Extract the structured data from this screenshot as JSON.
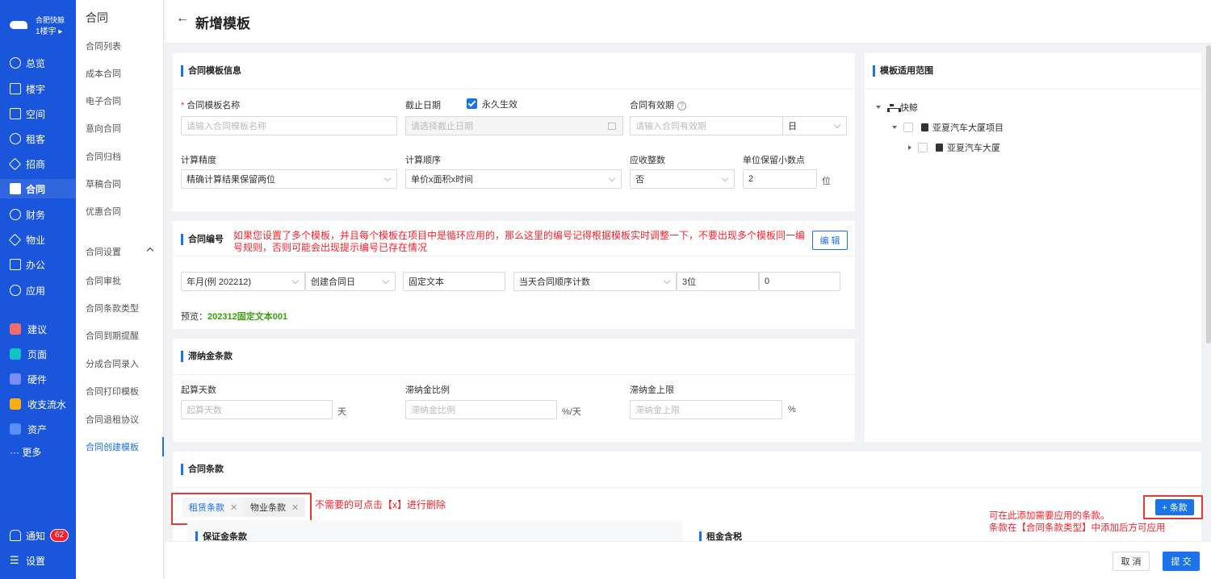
{
  "brand": {
    "name": "合肥快鲸",
    "building": "1楼宇"
  },
  "nav": [
    {
      "label": "总览",
      "icon": "dashboard-icon"
    },
    {
      "label": "楼宇",
      "icon": "building-icon"
    },
    {
      "label": "空间",
      "icon": "cube-icon"
    },
    {
      "label": "租客",
      "icon": "tenant-icon"
    },
    {
      "label": "招商",
      "icon": "tag-icon"
    },
    {
      "label": "合同",
      "icon": "contract-icon"
    },
    {
      "label": "财务",
      "icon": "finance-icon"
    },
    {
      "label": "物业",
      "icon": "home-icon"
    },
    {
      "label": "办公",
      "icon": "monitor-icon"
    },
    {
      "label": "应用",
      "icon": "app-icon"
    }
  ],
  "apps": [
    {
      "label": "建议",
      "color": "#f56c6c"
    },
    {
      "label": "页面",
      "color": "#13c2c2"
    },
    {
      "label": "硬件",
      "color": "#7b8cf7"
    },
    {
      "label": "收支流水",
      "color": "#faad14"
    },
    {
      "label": "资产",
      "color": "#5b8ff9"
    }
  ],
  "more_label": "··· 更多",
  "notify": {
    "label": "通知",
    "count": "62"
  },
  "settings_label": "设置",
  "submenu": {
    "title": "合同",
    "items": [
      "合同列表",
      "成本合同",
      "电子合同",
      "意向合同",
      "合同归档",
      "草稿合同",
      "优惠合同"
    ],
    "group": "合同设置",
    "group_items": [
      "合同审批",
      "合同条款类型",
      "合同到期提醒",
      "分成合同录入",
      "合同打印模板",
      "合同退租协议",
      "合同创建模板"
    ]
  },
  "page_title": "新增模板",
  "info": {
    "title": "合同模板信息",
    "name_label": "合同模板名称",
    "name_placeholder": "请输入合同模板名称",
    "deadline_label": "截止日期",
    "forever_label": "永久生效",
    "deadline_placeholder": "请选择截止日期",
    "validity_label": "合同有效期",
    "validity_placeholder": "请输入合同有效期",
    "validity_unit": "日",
    "precision_label": "计算精度",
    "precision_value": "精确计算结果保留两位",
    "order_label": "计算顺序",
    "order_value": "单价x面积x时间",
    "round_label": "应收整数",
    "round_value": "否",
    "decimal_label": "单位保留小数点",
    "decimal_value": "2",
    "decimal_unit": "位"
  },
  "numbering": {
    "title": "合同编号",
    "note": "如果您设置了多个模板，并且每个模板在项目中是循环应用的，那么这里的编号记得根据模板实时调整一下，不要出现多个模板同一编号规则，否则可能会出现提示编号已存在情况",
    "edit_label": "编 辑",
    "fields": [
      "年月(例 202212)",
      "创建合同日",
      "固定文本",
      "当天合同顺序计数",
      "3位",
      "0"
    ],
    "preview_label": "预览：",
    "preview_value": "202312固定文本001"
  },
  "late": {
    "title": "滞纳金条款",
    "start_label": "起算天数",
    "start_placeholder": "起算天数",
    "start_unit": "天",
    "ratio_label": "滞纳金比例",
    "ratio_placeholder": "滞纳金比例",
    "ratio_unit": "%/天",
    "cap_label": "滞纳金上限",
    "cap_placeholder": "滞纳金上限",
    "cap_unit": "%"
  },
  "scope": {
    "title": "模板适用范围",
    "tree": [
      "快鲸",
      "亚夏汽车大厦项目",
      "亚夏汽车大厦"
    ]
  },
  "terms": {
    "title": "合同条款",
    "tabs": [
      "租赁条款",
      "物业条款"
    ],
    "delete_note": "不需要的可点击【x】进行删除",
    "add_label": "+ 条款",
    "add_note": [
      "可在此添加需要应用的条款。",
      "条款在【合同条款类型】中添加后方可应用"
    ],
    "deposit_title": "保证金条款",
    "rent_title": "租金含税"
  },
  "footer": {
    "cancel": "取 消",
    "submit": "提 交"
  }
}
